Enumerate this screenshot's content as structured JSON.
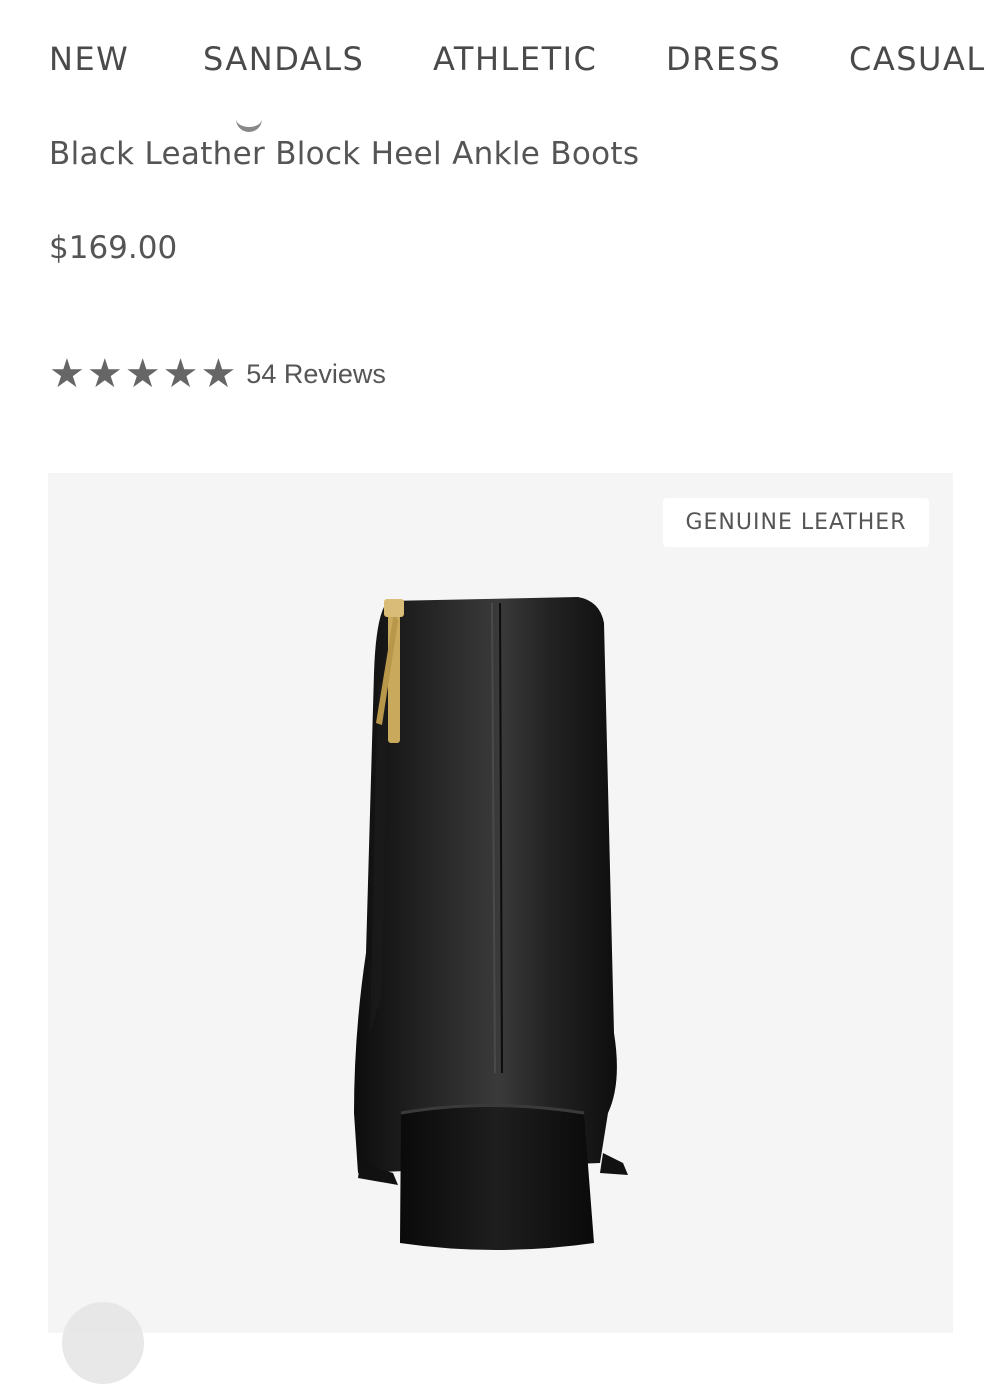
{
  "nav": {
    "items": [
      {
        "label": "NEW"
      },
      {
        "label": "SANDALS"
      },
      {
        "label": "ATHLETIC"
      },
      {
        "label": "DRESS"
      },
      {
        "label": "CASUAL"
      }
    ]
  },
  "product": {
    "subtitle": "Black Leather Block Heel Ankle Boots",
    "price": "$169.00",
    "rating": {
      "stars": 5,
      "reviews_label": "54 Reviews"
    },
    "badge": "GENUINE LEATHER"
  },
  "icons": {
    "star": "star-icon",
    "zipper": "zipper-icon"
  },
  "colors": {
    "star": "#666666",
    "text": "#555555",
    "image_bg": "#f5f5f5",
    "boot": "#1a1a1a",
    "zipper": "#c9a95c"
  }
}
